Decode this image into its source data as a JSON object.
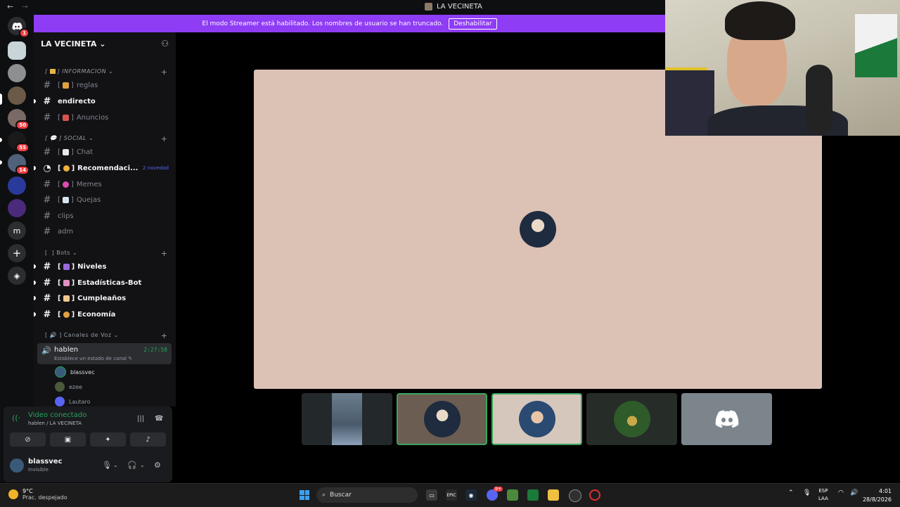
{
  "window": {
    "title": "LA VECINETA",
    "back": "←",
    "forward": "→"
  },
  "banner": {
    "text": "El modo Streamer está habilitado. Los nombres de usuario se han truncado.",
    "button": "Deshabilitar"
  },
  "guilds": {
    "discord_badge": "1",
    "badges": [
      "50",
      "55",
      "14"
    ],
    "m_label": "m"
  },
  "server": {
    "name": "LA VECINETA"
  },
  "categories": [
    {
      "label": "INFORMACION"
    },
    {
      "label": "SOCIAL"
    },
    {
      "label": "Bots"
    },
    {
      "label": "Canales de Voz"
    }
  ],
  "channels": {
    "reglas": "reglas",
    "endirecto": "endirecto",
    "anuncios": "Anuncios",
    "chat": "Chat",
    "recomendaciones": "Recomendaci...",
    "recomendaciones_badge": "2 novedad",
    "memes": "Memes",
    "quejas": "Quejas",
    "clips": "clips",
    "adm": "adm",
    "niveles": "Niveles",
    "estadisticas": "Estadísticas-Bot",
    "cumpleanos": "Cumpleaños",
    "economia": "Economía"
  },
  "voice": {
    "name": "hablen",
    "timer": "2:27:58",
    "status": "Establece un estado de canal",
    "users": [
      "blassvec",
      "ezee",
      "Lautaro"
    ]
  },
  "connection": {
    "title": "Video conectado",
    "subtitle": "hablen / LA VECINETA"
  },
  "user": {
    "name": "blassvec",
    "status": "Invisible"
  },
  "taskbar": {
    "temp": "9°C",
    "weather": "Prac. despejado",
    "search_placeholder": "Buscar",
    "discord_badge": "9+",
    "lang1": "ESP",
    "lang2": "LAA",
    "time": "4:01",
    "date": "28/8/2026"
  }
}
